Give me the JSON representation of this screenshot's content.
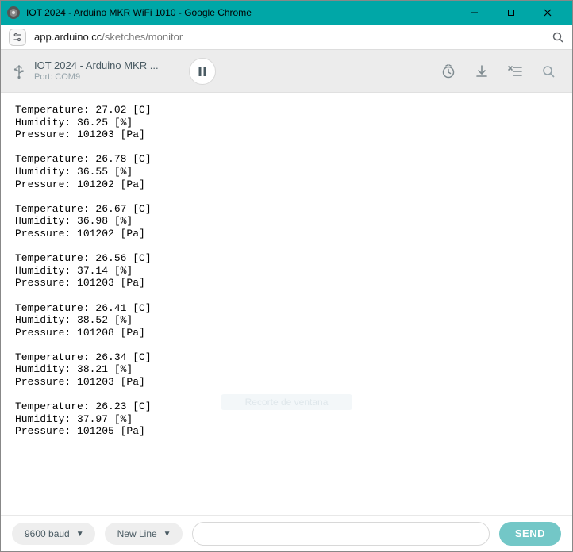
{
  "window": {
    "title": "IOT 2024 - Arduino MKR WiFi 1010 - Google Chrome"
  },
  "url": {
    "host": "app.arduino.cc",
    "path": "/sketches/monitor"
  },
  "header": {
    "sketch_title": "IOT 2024 - Arduino MKR ...",
    "port_label": "Port: COM9"
  },
  "monitor": {
    "readings": [
      {
        "temperature": "27.02",
        "humidity": "36.25",
        "pressure": "101203"
      },
      {
        "temperature": "26.78",
        "humidity": "36.55",
        "pressure": "101202"
      },
      {
        "temperature": "26.67",
        "humidity": "36.98",
        "pressure": "101202"
      },
      {
        "temperature": "26.56",
        "humidity": "37.14",
        "pressure": "101203"
      },
      {
        "temperature": "26.41",
        "humidity": "38.52",
        "pressure": "101208"
      },
      {
        "temperature": "26.34",
        "humidity": "38.21",
        "pressure": "101203"
      },
      {
        "temperature": "26.23",
        "humidity": "37.97",
        "pressure": "101205"
      }
    ],
    "labels": {
      "temperature": "Temperature",
      "humidity": "Humidity",
      "pressure": "Pressure",
      "temp_unit": "[C]",
      "hum_unit": "[%]",
      "press_unit": "[Pa]"
    },
    "watermark": "Recorte de ventana"
  },
  "bottom": {
    "baud_label": "9600 baud",
    "lineend_label": "New Line",
    "send_label": "SEND",
    "input_value": ""
  }
}
